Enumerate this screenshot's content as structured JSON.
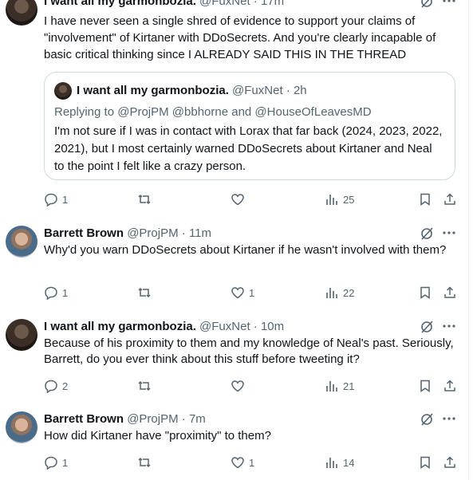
{
  "posts": [
    {
      "name": "I want all my garmonbozia.",
      "handle": "@FuxNet",
      "dot": "·",
      "time": "17m",
      "text": "I have never seen a single shred of evidence to support your claims of \"involvement\" of Kirtaner with DDoSecrets. And you're clearly incapable of basic critical thinking since I ALREADY SAID THIS IN THE THREAD",
      "quote": {
        "name": "I want all my garmonbozia.",
        "handle": "@FuxNet",
        "dot": "·",
        "time": "2h",
        "replying_prefix": "Replying to ",
        "replying_to": "@ProjPM @bbhorne and @HouseOfLeavesMD",
        "text": "I'm not sure if I was in contact with Lorax that far back (2024, 2023, 2022, 2021), but I most certainly warned DDoSecrets about Kirtaner and Neal to the point I felt like a crazy person."
      },
      "replies": "1",
      "likes": "",
      "views": "25"
    },
    {
      "name": "Barrett Brown",
      "handle": "@ProjPM",
      "dot": "·",
      "time": "11m",
      "text": "Why'd you warn DDoSecrets about Kirtaner if he wasn't involved with them?",
      "replies": "1",
      "likes": "1",
      "views": "22"
    },
    {
      "name": "I want all my garmonbozia.",
      "handle": "@FuxNet",
      "dot": "·",
      "time": "10m",
      "text": "Because of his proximity to them and my knowledge of Neal's past. Seriously, Barrett, do you ever think about this stuff before tweeting it?",
      "replies": "2",
      "likes": "",
      "views": "21"
    },
    {
      "name": "Barrett Brown",
      "handle": "@ProjPM",
      "dot": "·",
      "time": "7m",
      "text": "How did Kirtaner have \"proximity\" to them?",
      "replies": "1",
      "likes": "1",
      "views": "14"
    }
  ],
  "icons": {
    "reply": "reply-icon",
    "repost": "repost-icon",
    "like": "heart-icon",
    "views": "views-icon",
    "bookmark": "bookmark-icon",
    "share": "share-icon",
    "grok": "grok-icon",
    "more": "more-icon"
  },
  "colors": {
    "text": "#0f1419",
    "secondary": "#536471",
    "border": "#cfd9de",
    "link": "#1d9bf0"
  }
}
